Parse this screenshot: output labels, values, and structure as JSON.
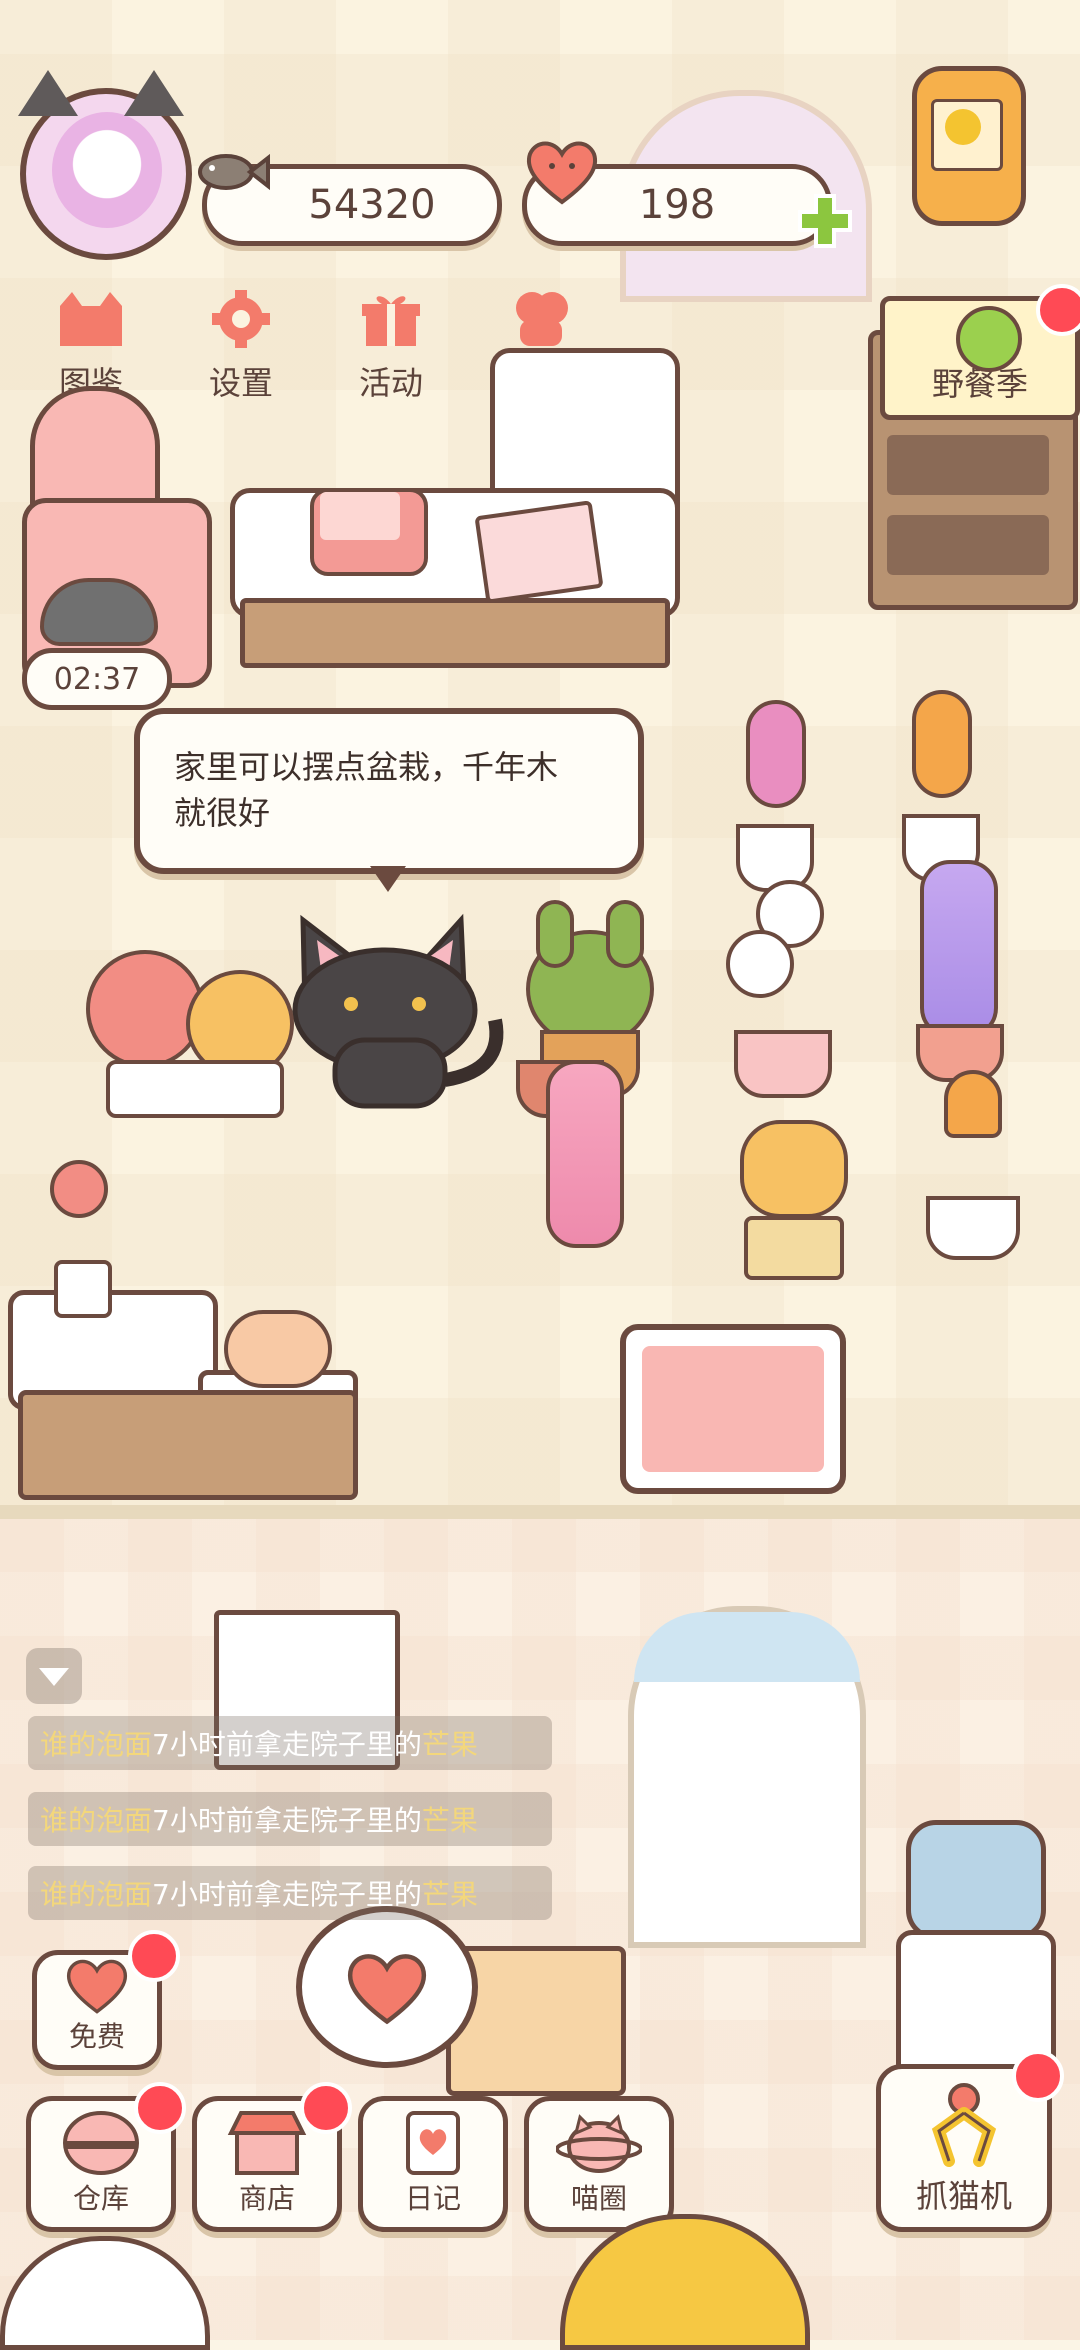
{
  "currency": {
    "fish_amount": "54320",
    "heart_amount": "198"
  },
  "nav": [
    {
      "label": "图鉴",
      "icon": "cat-book-icon"
    },
    {
      "label": "设置",
      "icon": "gear-icon"
    },
    {
      "label": "活动",
      "icon": "gift-icon"
    },
    {
      "label": "好友",
      "icon": "friends-icon"
    }
  ],
  "event_banner": {
    "label": "野餐季"
  },
  "timer": {
    "value": "02:37"
  },
  "speech": {
    "text_line1": "家里可以摆点盆栽，千年木",
    "text_line2": "就很好"
  },
  "feed": [
    {
      "who": "谁的泡面",
      "action": "7小时前拿走院子里的",
      "item": "芒果"
    },
    {
      "who": "谁的泡面",
      "action": "7小时前拿走院子里的",
      "item": "芒果"
    },
    {
      "who": "谁的泡面",
      "action": "7小时前拿走院子里的",
      "item": "芒果"
    }
  ],
  "bottom_buttons": {
    "free": "免费",
    "warehouse": "仓库",
    "shop": "商店",
    "diary": "日记",
    "circle": "喵圈",
    "catch_cat": "抓猫机"
  },
  "colors": {
    "outline": "#6b4a3f",
    "accent_pink": "#f37b6b",
    "badge_red": "#ff4a55",
    "plus_green": "#8cc63f",
    "highlight_yellow": "#f3d77c"
  }
}
